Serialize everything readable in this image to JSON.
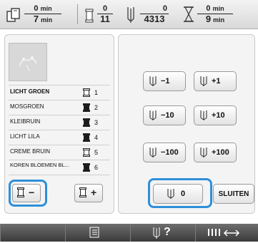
{
  "status": {
    "time": {
      "current": "0",
      "total": "7",
      "unit": "min"
    },
    "color_changes": {
      "current": "0",
      "total": "11"
    },
    "stitches": {
      "current": "0",
      "total": "4313"
    },
    "remaining_time": {
      "current": "0",
      "total": "9",
      "unit": "min"
    }
  },
  "threads": [
    {
      "name": "LICHT GROEN",
      "number": "1",
      "spool_color": "#ffffff"
    },
    {
      "name": "MOSGROEN",
      "number": "2",
      "spool_color": "#1a1a1a"
    },
    {
      "name": "KLEIBRUIN",
      "number": "3",
      "spool_color": "#1a1a1a"
    },
    {
      "name": "LICHT LILA",
      "number": "4",
      "spool_color": "#1a1a1a"
    },
    {
      "name": "CREME BRUIN",
      "number": "5",
      "spool_color": "#ffffff"
    },
    {
      "name": "KOREN BLOEMEN BL...",
      "number": "6",
      "spool_color": "#1a1a1a"
    }
  ],
  "spool_buttons": {
    "minus": "−",
    "plus": "+"
  },
  "move_buttons": [
    {
      "label": "−1"
    },
    {
      "label": "+1"
    },
    {
      "label": "−10"
    },
    {
      "label": "+10"
    },
    {
      "label": "−100"
    },
    {
      "label": "+100"
    }
  ],
  "needle_zero": "0",
  "close_label": "SLUITEN",
  "highlight_color": "#2f8fd9",
  "bottom_icons": [
    "list-icon",
    "needle-help-icon",
    "thread-move-icon"
  ],
  "bottom_help": "?"
}
